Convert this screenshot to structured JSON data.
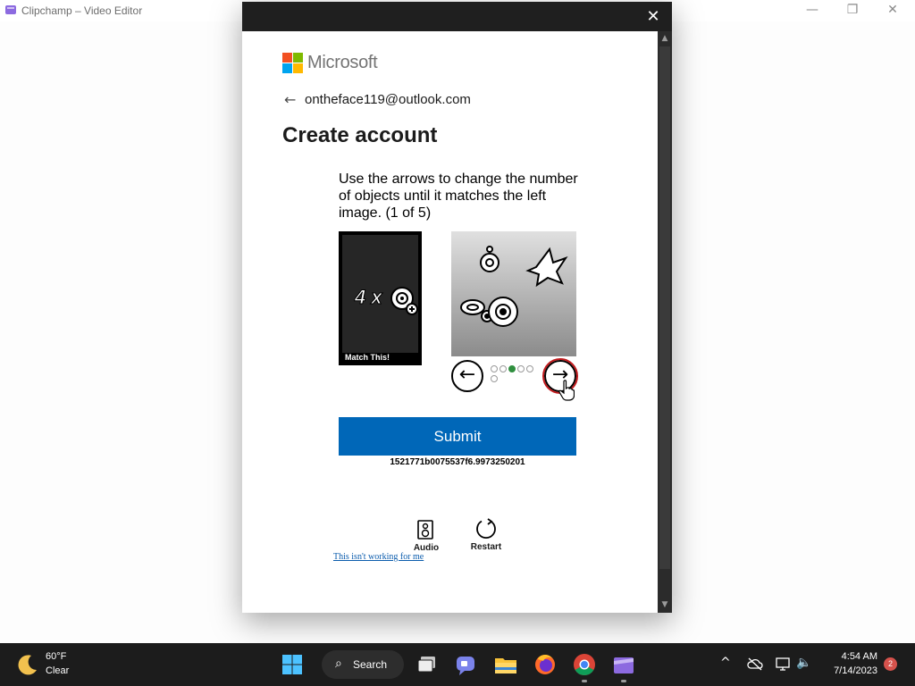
{
  "app_window": {
    "title": "Clipchamp – Video Editor",
    "minimize": "—",
    "maximize": "❐",
    "close": "✕"
  },
  "dialog": {
    "close": "✕",
    "brand": "Microsoft",
    "back_glyph": "←",
    "email": "ontheface119@outlook.com",
    "heading": "Create account",
    "puzzle": {
      "instructions": "Use the arrows to change the number of objects until it matches the left image. (1 of 5)",
      "target_count": "4 x",
      "target_caption": "Match This!",
      "prev_glyph": "←",
      "next_glyph": "→",
      "dots_total": 6,
      "active_dot": 3,
      "submit_label": "Submit",
      "token": "1521771b0075537f6.9973250201",
      "audio_label": "Audio",
      "restart_label": "Restart",
      "help_link": "This isn't working for me"
    }
  },
  "taskbar": {
    "weather": {
      "temp": "60°F",
      "condition": "Clear"
    },
    "search_label": "Search",
    "search_glyph": "⌕",
    "tray": {
      "chevron": "^",
      "volume": "🔈"
    },
    "time": "4:54 AM",
    "date": "7/14/2023",
    "notification_count": "2"
  },
  "colors": {
    "accent": "#0067b8",
    "dialog_bar": "#1f1f1f",
    "taskbar": "#1c1c1c",
    "ms_red": "#f25022",
    "ms_green": "#7fba00",
    "ms_blue": "#00a4ef",
    "ms_yellow": "#ffb900",
    "highlight": "#c0191c",
    "active_dot": "#2f8f3e"
  }
}
